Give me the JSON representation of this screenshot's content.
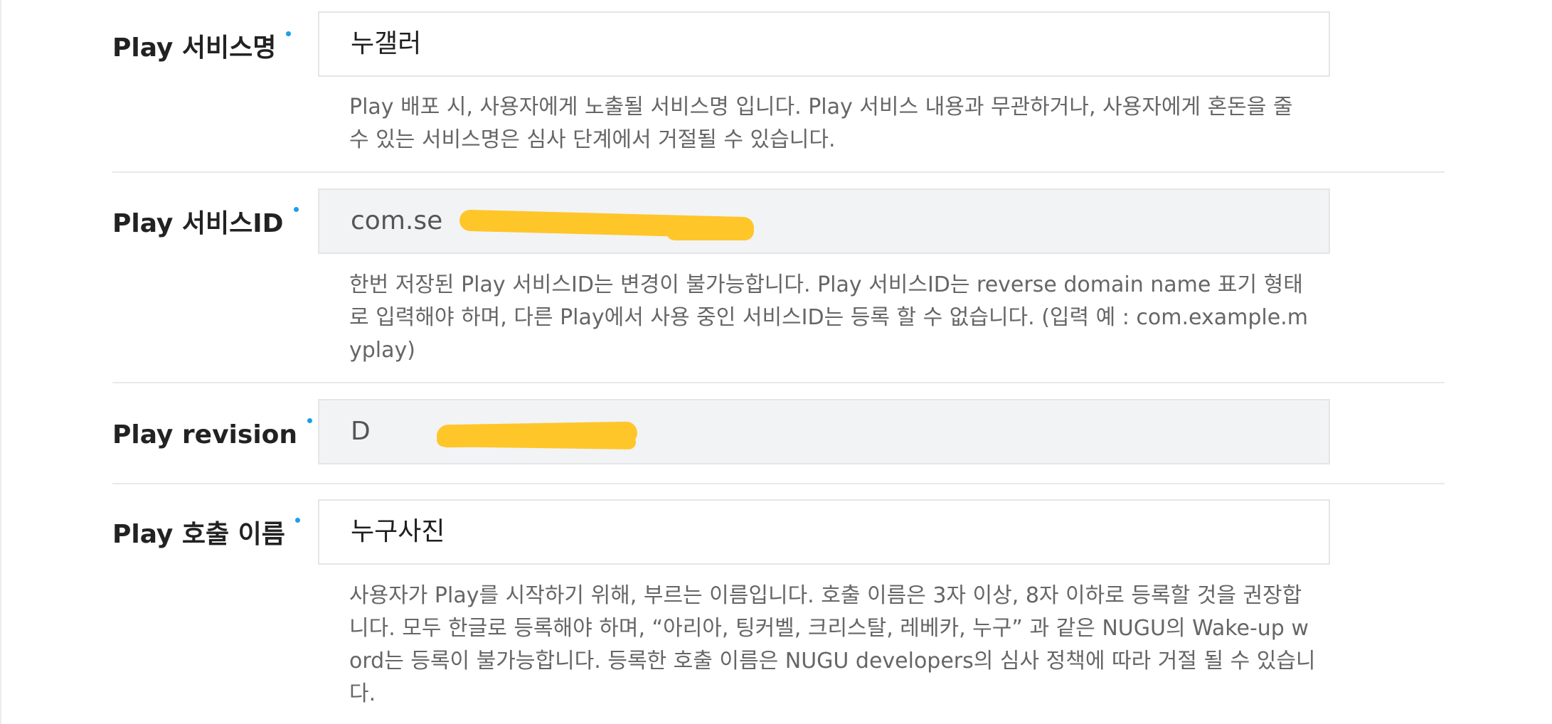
{
  "form": {
    "service_name": {
      "label": "Play 서비스명",
      "value": "누갤러",
      "help": "Play 배포 시, 사용자에게 노출될 서비스명 입니다. Play 서비스 내용과 무관하거나, 사용자에게 혼돈을 줄 수 있는 서비스명은 심사 단계에서 거절될 수 있습니다."
    },
    "service_id": {
      "label": "Play 서비스ID",
      "value": "com.se",
      "help": "한번 저장된 Play 서비스ID는 변경이 불가능합니다. Play 서비스ID는 reverse domain name 표기 형태로 입력해야 하며, 다른 Play에서 사용 중인 서비스ID는 등록 할 수 없습니다. (입력 예 : com.example.myplay)"
    },
    "revision": {
      "label": "Play revision",
      "value": "D"
    },
    "invocation_name": {
      "label": "Play 호출 이름",
      "value": "누구사진",
      "help": "사용자가 Play를 시작하기 위해, 부르는 이름입니다. 호출 이름은 3자 이상, 8자 이하로 등록할 것을 권장합니다. 모두 한글로 등록해야 하며, “아리아, 팅커벨, 크리스탈, 레베카, 누구” 과 같은 NUGU의 Wake-up word는 등록이 불가능합니다. 등록한 호출 이름은 NUGU developers의 심사 정책에 따라 거절 될 수 있습니다."
    }
  },
  "colors": {
    "required_dot": "#1aa0e6",
    "redaction": "#ffc629",
    "readonly_bg": "#f1f3f5",
    "border": "#e3e5e8"
  }
}
